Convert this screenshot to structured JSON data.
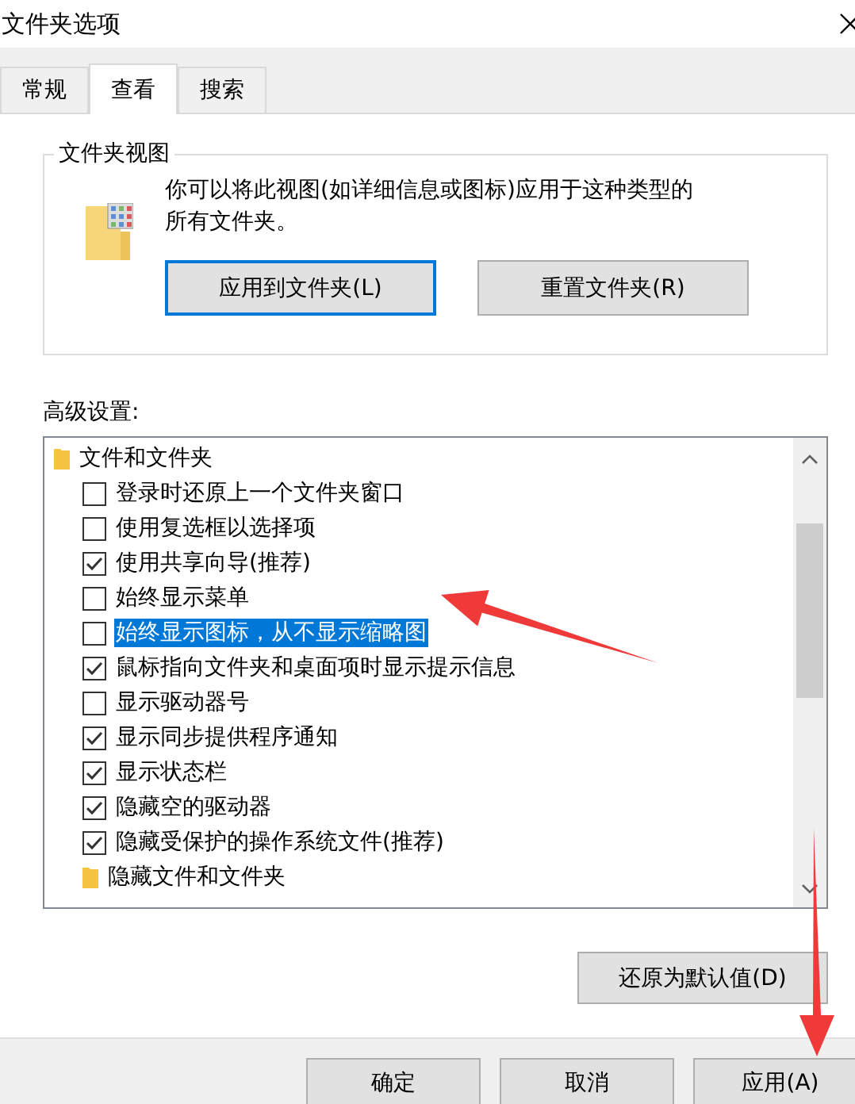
{
  "window": {
    "title": "文件夹选项"
  },
  "tabs": [
    {
      "label": "常规",
      "selected": false
    },
    {
      "label": "查看",
      "selected": true
    },
    {
      "label": "搜索",
      "selected": false
    }
  ],
  "folder_views": {
    "title": "文件夹视图",
    "description": "你可以将此视图(如详细信息或图标)应用于这种类型的所有文件夹。",
    "buttons": [
      {
        "label": "应用到文件夹(L)",
        "focused": true
      },
      {
        "label": "重置文件夹(R)",
        "focused": false
      }
    ]
  },
  "advanced": {
    "label": "高级设置:",
    "items": [
      {
        "kind": "folder",
        "label": "文件和文件夹",
        "selected": false,
        "children": [
          {
            "kind": "checkbox",
            "label": "登录时还原上一个文件夹窗口",
            "checked": false,
            "selected": false
          },
          {
            "kind": "checkbox",
            "label": "使用复选框以选择项",
            "checked": false,
            "selected": false
          },
          {
            "kind": "checkbox",
            "label": "使用共享向导(推荐)",
            "checked": true,
            "selected": false
          },
          {
            "kind": "checkbox",
            "label": "始终显示菜单",
            "checked": false,
            "selected": false
          },
          {
            "kind": "checkbox",
            "label": "始终显示图标，从不显示缩略图",
            "checked": false,
            "selected": true
          },
          {
            "kind": "checkbox",
            "label": "鼠标指向文件夹和桌面项时显示提示信息",
            "checked": true,
            "selected": false
          },
          {
            "kind": "checkbox",
            "label": "显示驱动器号",
            "checked": false,
            "selected": false
          },
          {
            "kind": "checkbox",
            "label": "显示同步提供程序通知",
            "checked": true,
            "selected": false
          },
          {
            "kind": "checkbox",
            "label": "显示状态栏",
            "checked": true,
            "selected": false
          },
          {
            "kind": "checkbox",
            "label": "隐藏空的驱动器",
            "checked": true,
            "selected": false
          },
          {
            "kind": "checkbox",
            "label": "隐藏受保护的操作系统文件(推荐)",
            "checked": true,
            "selected": false
          },
          {
            "kind": "folder",
            "label": "隐藏文件和文件夹",
            "selected": false
          }
        ]
      }
    ],
    "restore_button": "还原为默认值(D)"
  },
  "buttons": [
    {
      "label": "确定"
    },
    {
      "label": "取消"
    },
    {
      "label": "应用(A)"
    }
  ]
}
